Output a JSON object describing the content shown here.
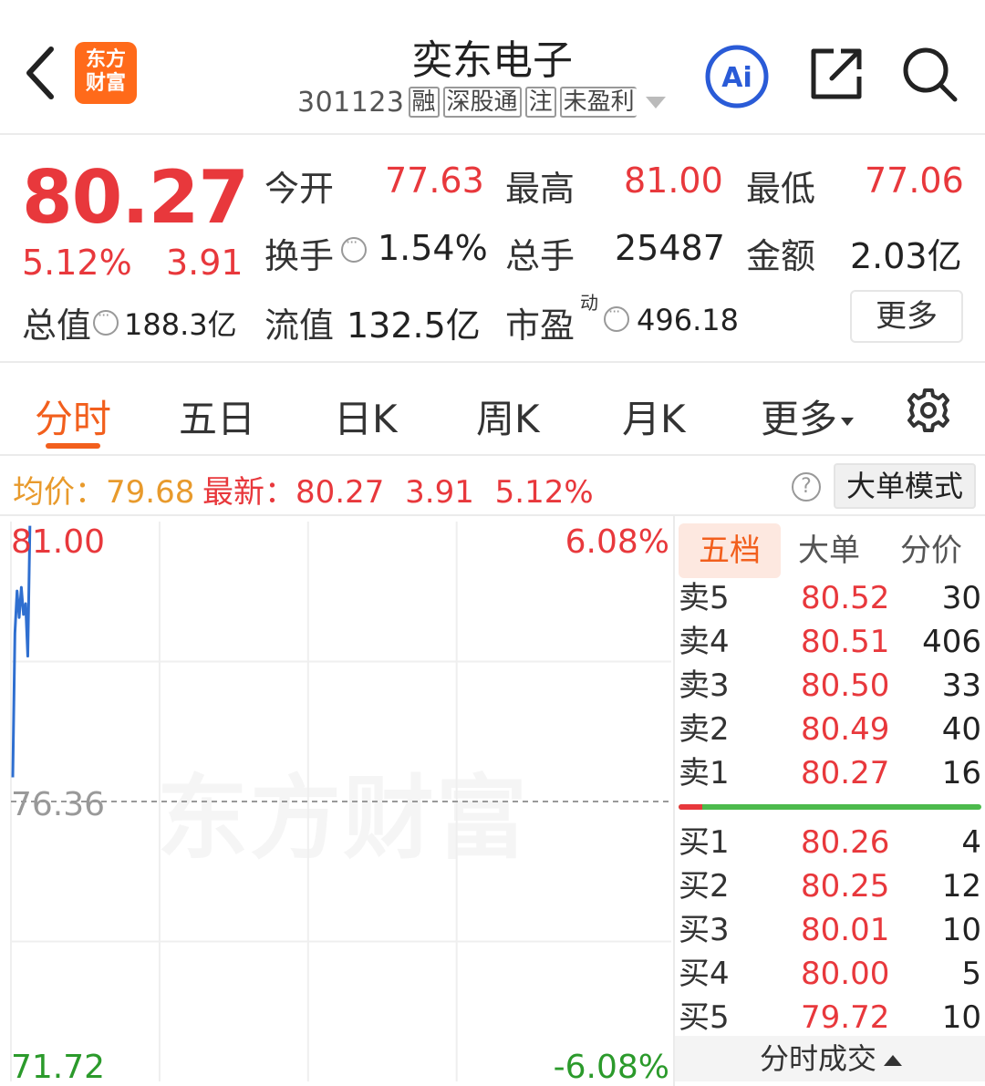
{
  "header": {
    "logo_line1": "东方",
    "logo_line2": "财富",
    "stock_name": "奕东电子",
    "stock_code": "301123",
    "tags": [
      "融",
      "深股通",
      "注",
      "未盈利"
    ],
    "icons": [
      "back-icon",
      "ai-icon",
      "share-icon",
      "search-icon"
    ]
  },
  "quote": {
    "price": "80.27",
    "change_pct": "5.12%",
    "change": "3.91",
    "total_value_label": "总值",
    "total_value": "188.3亿",
    "open_label": "今开",
    "open": "77.63",
    "high_label": "最高",
    "high": "81.00",
    "low_label": "最低",
    "low": "77.06",
    "turnover_label": "换手",
    "turnover": "1.54%",
    "volume_label": "总手",
    "volume": "25487",
    "amount_label": "金额",
    "amount": "2.03亿",
    "float_value_label": "流值",
    "float_value": "132.5亿",
    "pe_label": "市盈",
    "pe_sup": "动",
    "pe": "496.18",
    "more_label": "更多",
    "colors": {
      "up": "#e8383c",
      "accent": "#f25f1d"
    }
  },
  "tabs": {
    "items": [
      "分时",
      "五日",
      "日K",
      "周K",
      "月K",
      "更多"
    ],
    "active": "分时"
  },
  "infobar": {
    "avg_label": "均价：",
    "avg": "79.68",
    "latest_label": "最新：",
    "latest": "80.27",
    "change": "3.91",
    "change_pct": "5.12%",
    "help": "?",
    "big_order_mode": "大单模式"
  },
  "chart": {
    "watermark": "东方财富",
    "y_top": "81.00",
    "y_mid": "76.36",
    "y_bottom": "71.72",
    "pct_top": "6.08%",
    "pct_bottom": "-6.08%"
  },
  "chart_data": {
    "type": "line",
    "title": "",
    "ylim": [
      71.72,
      81.0
    ],
    "prev_close": 76.36,
    "x": [
      0,
      1,
      2,
      3,
      4,
      5,
      6,
      7,
      8
    ],
    "series": [
      {
        "values": [
          76.76,
          79.15,
          79.85,
          79.41,
          79.91,
          79.46,
          79.64,
          78.77,
          80.93
        ]
      }
    ],
    "grid": true
  },
  "orderbook": {
    "tabs": [
      "五档",
      "大单",
      "分价"
    ],
    "sells": [
      {
        "label": "卖5",
        "price": "80.52",
        "qty": "30"
      },
      {
        "label": "卖4",
        "price": "80.51",
        "qty": "406"
      },
      {
        "label": "卖3",
        "price": "80.50",
        "qty": "33"
      },
      {
        "label": "卖2",
        "price": "80.49",
        "qty": "40"
      },
      {
        "label": "卖1",
        "price": "80.27",
        "qty": "16"
      }
    ],
    "buys": [
      {
        "label": "买1",
        "price": "80.26",
        "qty": "4"
      },
      {
        "label": "买2",
        "price": "80.25",
        "qty": "12"
      },
      {
        "label": "买3",
        "price": "80.01",
        "qty": "10"
      },
      {
        "label": "买4",
        "price": "80.00",
        "qty": "5"
      },
      {
        "label": "买5",
        "price": "79.72",
        "qty": "10"
      }
    ],
    "deals_label": "分时成交"
  }
}
